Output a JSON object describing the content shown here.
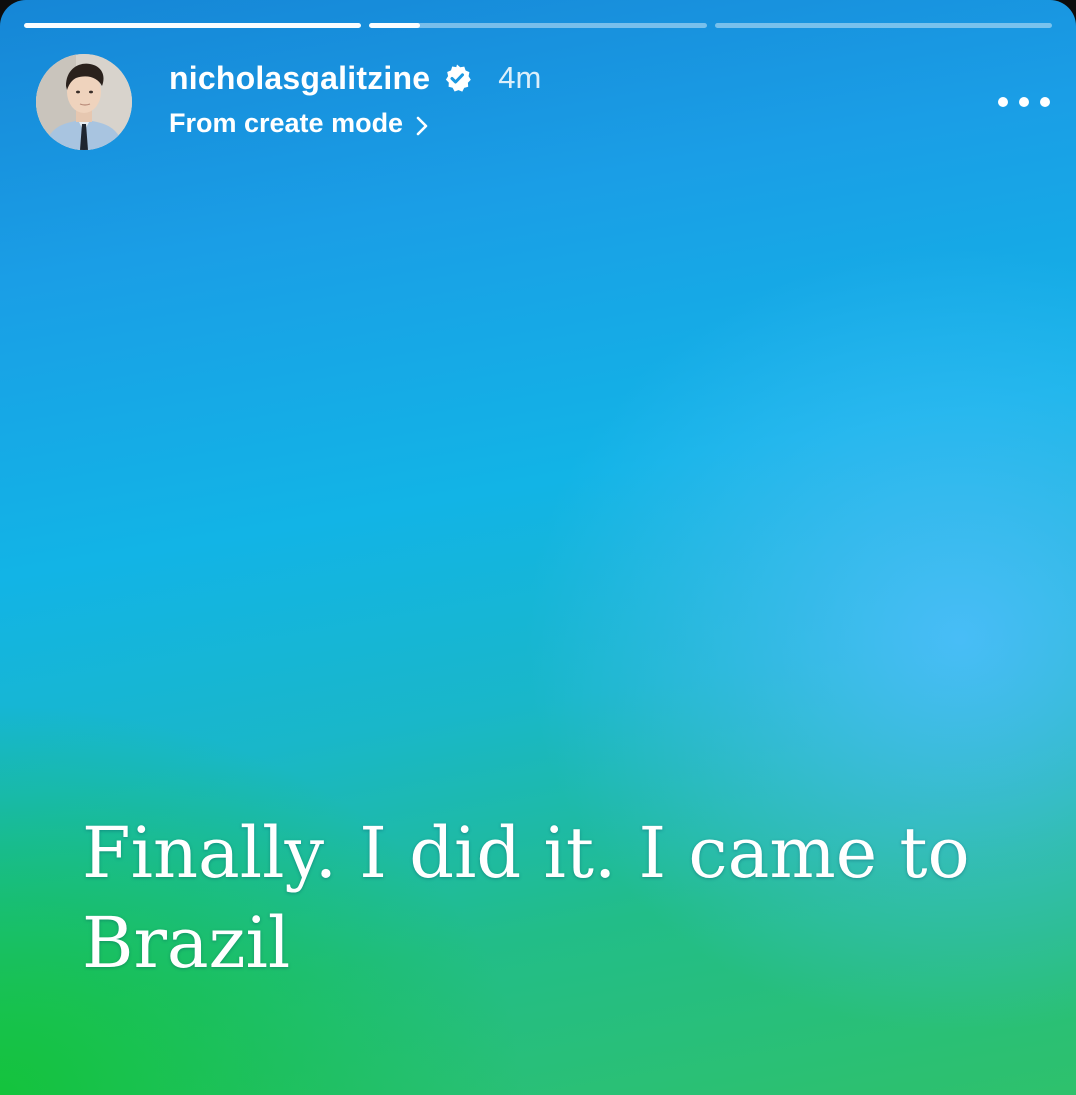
{
  "story": {
    "progress": [
      {
        "fill": 1.0
      },
      {
        "fill": 0.15
      },
      {
        "fill": 0.0
      }
    ],
    "header": {
      "username": "nicholasgalitzine",
      "verified_icon": "verified-badge-icon",
      "time_ago": "4m",
      "subtitle": "From create mode",
      "subtitle_icon": "chevron-right-icon",
      "more_icon": "more-options-icon"
    },
    "caption": "Finally. I did it. I came to Brazil"
  },
  "colors": {
    "top": "#1686d6",
    "middle": "#12b4e6",
    "bottom_left": "#14c33c"
  }
}
